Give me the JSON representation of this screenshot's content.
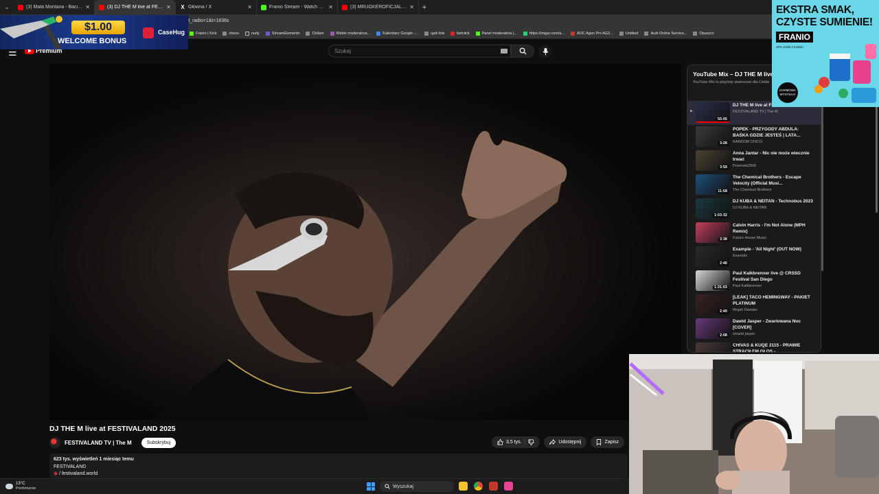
{
  "browser": {
    "tabs": [
      {
        "label": "(3) Mata Montana - Baciata [Official",
        "icon": "youtube-icon",
        "active": false
      },
      {
        "label": "(3) DJ THE M live at FESTIVALAND",
        "icon": "youtube-icon",
        "active": true
      },
      {
        "label": "Główna / X",
        "icon": "x-icon",
        "active": false
      },
      {
        "label": "Franio Stream - Watch Live on Kick",
        "icon": "kick-icon",
        "active": false
      },
      {
        "label": "(3) MRUGKEROFICJALNIE GDZIE",
        "icon": "youtube-icon",
        "active": false
      }
    ],
    "address_fragment": "rt_radio=1&t=1836s",
    "bookmarks": [
      "Franio | Kick",
      "chess",
      "nudy",
      "StreamElements",
      "Chilam",
      "Widok moderatora...",
      "Kalendarz Google -...",
      "ujeb link",
      "betclick",
      "Panel moderatora |...",
      "https://imgur.com/a...",
      "AOC Agon Pro AG2...",
      "Untitled",
      "Audi Online Service...",
      "Opuszcz"
    ]
  },
  "youtube": {
    "logo_text": "Premium",
    "search_placeholder": "Szukaj"
  },
  "video": {
    "title": "DJ THE M live at FESTIVALAND 2025",
    "channel": "FESTIVALAND TV | The M",
    "subscribe_label": "Subskrybuj",
    "likes": "3,5 tys.",
    "share_label": "Udostępnij",
    "save_label": "Zapisz",
    "views_line": "623 tys. wyświetleń  1 miesiąc temu",
    "desc_line1": "FESTIVALAND",
    "desc_line2": "/ festivaland.world"
  },
  "playlist": {
    "title": "YouTube Mix – DJ THE M live",
    "subtitle": "YouTube Mix to playlisty stworzone dla Ciebie",
    "items": [
      {
        "title": "DJ THE M live at FESTIVALAND 2025",
        "channel": "FESTIVALAND TV | The M",
        "duration": "55:05",
        "current": true,
        "thumb_color": "#2a2f4a"
      },
      {
        "title": "POPEK - PRZYGODY ABDULA: BAŚKA GDZIE JESTEŚ | LATA...",
        "channel": "RANDOM DISCO",
        "duration": "3:28",
        "current": false,
        "thumb_color": "#3b3b3b"
      },
      {
        "title": "Anna Jantar - Nic nie może wiecznie trwać",
        "channel": "Przemek2500",
        "duration": "3:59",
        "current": false,
        "thumb_color": "#4a4233"
      },
      {
        "title": "The Chemical Brothers - Escape Velocity (Official Musi...",
        "channel": "The Chemical Brothers",
        "duration": "11:58",
        "current": false,
        "thumb_color": "#1e4f7a"
      },
      {
        "title": "DJ KUBA & NEITAN - Technobus 2023",
        "channel": "DJ KUBA & NEITAN",
        "duration": "1:03:32",
        "current": false,
        "thumb_color": "#1c3a3f"
      },
      {
        "title": "Calvin Harris - I'm Not Alone (MPH Remix)",
        "channel": "Future House Music",
        "duration": "3:38",
        "current": false,
        "thumb_color": "#c2405e"
      },
      {
        "title": "Example - 'All Night' (OUT NOW)",
        "channel": "Example",
        "duration": "2:46",
        "current": false,
        "thumb_color": "#2b2b2b"
      },
      {
        "title": "Paul Kalkbrenner live @ CRSSD Festival San Diego",
        "channel": "Paul Kalkbrenner",
        "duration": "1:31:03",
        "current": false,
        "thumb_color": "#d8d8d8"
      },
      {
        "title": "[LEAK] TACO HEMINGWAY - PAKIET PLATINUM",
        "channel": "Wujek Damian",
        "duration": "2:40",
        "current": false,
        "thumb_color": "#3a2222"
      },
      {
        "title": "Dawid Jasper - Zwariowana Noc [COVER]",
        "channel": "smarki jasper",
        "duration": "2:08",
        "current": false,
        "thumb_color": "#6a3a7a"
      },
      {
        "title": "CHIVAS & KUQE 2115 - PRAWIE STRACIŁEM GŁOS -...",
        "channel": "",
        "duration": "",
        "current": false,
        "thumb_color": "#4a3a3a"
      }
    ]
  },
  "ads": {
    "casino": {
      "amount": "$1.00",
      "bonus": "WELCOME BONUS",
      "brand": "CaseHug"
    },
    "franio": {
      "line1": "EKSTRA SMAK,",
      "line2": "CZYSTE SUMIENIE!",
      "brand": "FRANIO",
      "tagline": "10% zniżki z kodem",
      "badge": "DARMOWA WYSYŁKA!"
    }
  },
  "taskbar": {
    "temperature": "13°C",
    "condition": "Pochmurnie",
    "search_placeholder": "Wyszukaj"
  }
}
